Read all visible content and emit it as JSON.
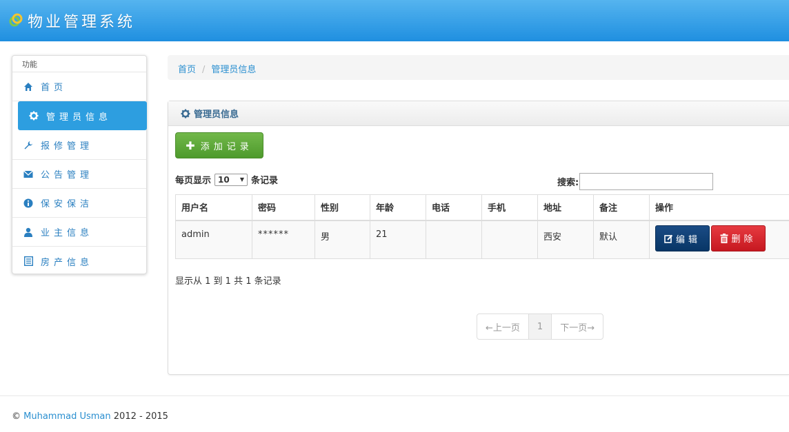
{
  "header": {
    "title": "物业管理系统"
  },
  "sidebar": {
    "heading": "功能",
    "items": [
      {
        "label": "首页",
        "icon": "home-icon"
      },
      {
        "label": "管理员信息",
        "icon": "gear-icon",
        "active": true
      },
      {
        "label": "报修管理",
        "icon": "wrench-icon"
      },
      {
        "label": "公告管理",
        "icon": "envelope-icon"
      },
      {
        "label": "保安保洁",
        "icon": "info-icon"
      },
      {
        "label": "业主信息",
        "icon": "user-icon"
      },
      {
        "label": "房产信息",
        "icon": "list-icon"
      }
    ]
  },
  "breadcrumb": {
    "home": "首页",
    "separator": "/",
    "current": "管理员信息"
  },
  "panel": {
    "title": "管理员信息",
    "add_button": "添加记录",
    "page_size_prefix": "每页显示",
    "page_size_value": "10",
    "page_size_suffix": "条记录",
    "search_label": "搜索:",
    "search_value": "",
    "columns": [
      "用户名",
      "密码",
      "性别",
      "年龄",
      "电话",
      "手机",
      "地址",
      "备注",
      "操作"
    ],
    "rows": [
      {
        "username": "admin",
        "password": "******",
        "gender": "男",
        "age": "21",
        "phone": "",
        "mobile": "",
        "address": "西安",
        "remark": "默认"
      }
    ],
    "edit_button": "编辑",
    "delete_button": "删除",
    "info_text": "显示从 1 到 1 共 1 条记录",
    "pager": {
      "prev": "←上一页",
      "current": "1",
      "next": "下一页→"
    }
  },
  "footer": {
    "copyright": "©",
    "author": "Muhammad Usman",
    "years": "2012 - 2015"
  },
  "colors": {
    "header": "#2b9be6",
    "active": "#2d9ee0",
    "add": "#5ba836",
    "edit": "#0d3b6e",
    "delete": "#d9232b"
  }
}
